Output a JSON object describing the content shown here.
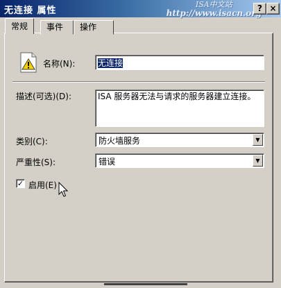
{
  "window": {
    "title": "无连接 属性",
    "watermark_line1": "ISA中文站",
    "watermark_line2": "http://www.isacn.org",
    "help_label": "?",
    "close_label": "×"
  },
  "tabs": [
    {
      "label": "常规",
      "active": true
    },
    {
      "label": "事件",
      "active": false
    },
    {
      "label": "操作",
      "active": false
    }
  ],
  "general": {
    "name_label": "名称(N):",
    "name_value": "无连接",
    "description_label": "描述(可选)(D):",
    "description_value": "ISA 服务器无法与请求的服务器建立连接。",
    "category_label": "类别(C):",
    "category_value": "防火墙服务",
    "severity_label": "严重性(S):",
    "severity_value": "错误",
    "enabled_label": "启用(E)",
    "enabled_checked": true,
    "check_mark": "✓",
    "dropdown_arrow": "▼"
  },
  "icons": {
    "alert": "warning-icon",
    "pointer": "mouse-cursor-icon"
  },
  "colors": {
    "title_bar_start": "#0a246a",
    "title_bar_end": "#a6caf0",
    "dialog_face": "#d4d0c8",
    "selection": "#0a246a"
  }
}
